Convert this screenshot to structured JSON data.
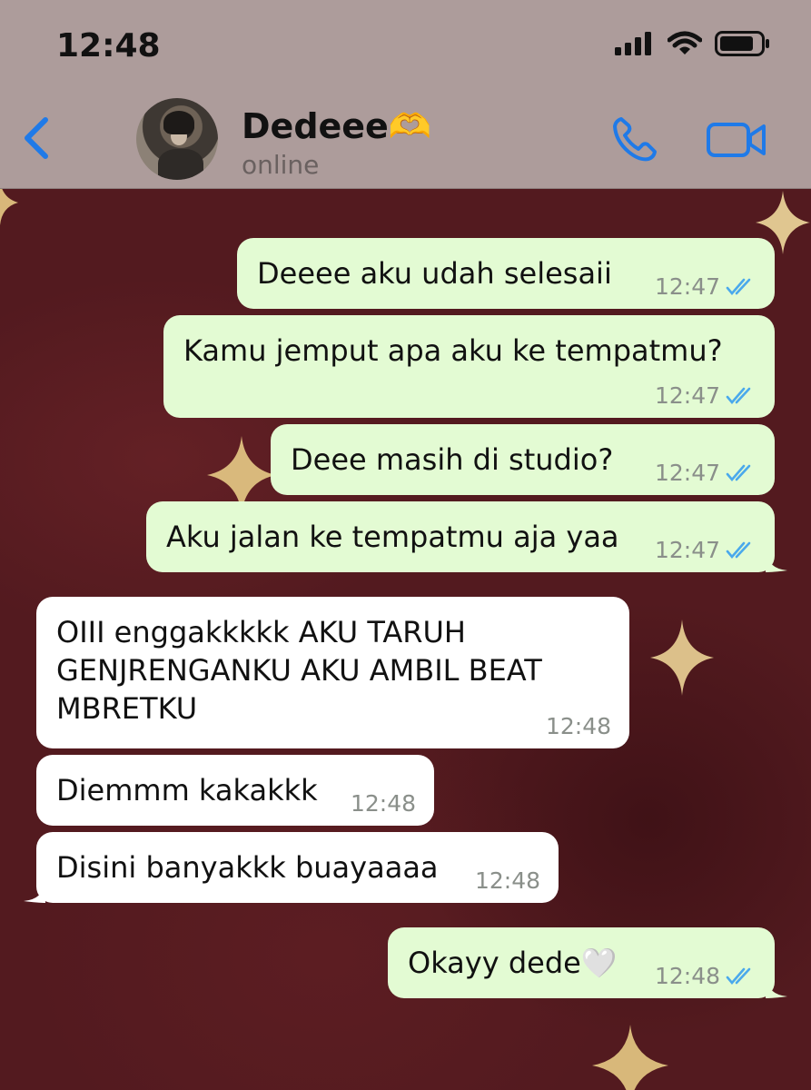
{
  "status_bar": {
    "time": "12:48"
  },
  "header": {
    "contact_name": "Dedeee🫶",
    "contact_status": "online"
  },
  "messages": [
    {
      "direction": "out",
      "text": "Deeee aku udah selesaii",
      "time": "12:47",
      "read": true
    },
    {
      "direction": "out",
      "text": "Kamu jemput apa aku ke tempatmu?",
      "time": "12:47",
      "read": true
    },
    {
      "direction": "out",
      "text": "Deee masih di studio?",
      "time": "12:47",
      "read": true
    },
    {
      "direction": "out",
      "text": "Aku jalan ke tempatmu aja yaa",
      "time": "12:47",
      "read": true
    },
    {
      "direction": "in",
      "text_lines": [
        "OIII enggakkkkk AKU TARUH",
        "GENJRENGANKU AKU AMBIL BEAT",
        "MBRETKU"
      ],
      "time": "12:48"
    },
    {
      "direction": "in",
      "text": "Diemmm kakakkk",
      "time": "12:48"
    },
    {
      "direction": "in",
      "text": "Disini banyakkk buayaaaa",
      "time": "12:48"
    },
    {
      "direction": "out",
      "text": "Okayy dede🤍",
      "time": "12:48",
      "read": true
    }
  ],
  "colors": {
    "header_bg": "#ad9c9b",
    "accent_blue": "#1f7ae8",
    "outgoing_bubble": "#e3fbd3",
    "incoming_bubble": "#ffffff",
    "read_ticks": "#4aa9ec",
    "wallpaper": "#531a1f"
  },
  "icons": [
    "back-chevron-icon",
    "phone-icon",
    "video-camera-icon",
    "signal-icon",
    "wifi-icon",
    "battery-icon",
    "double-check-icon",
    "sparkle-icon"
  ]
}
